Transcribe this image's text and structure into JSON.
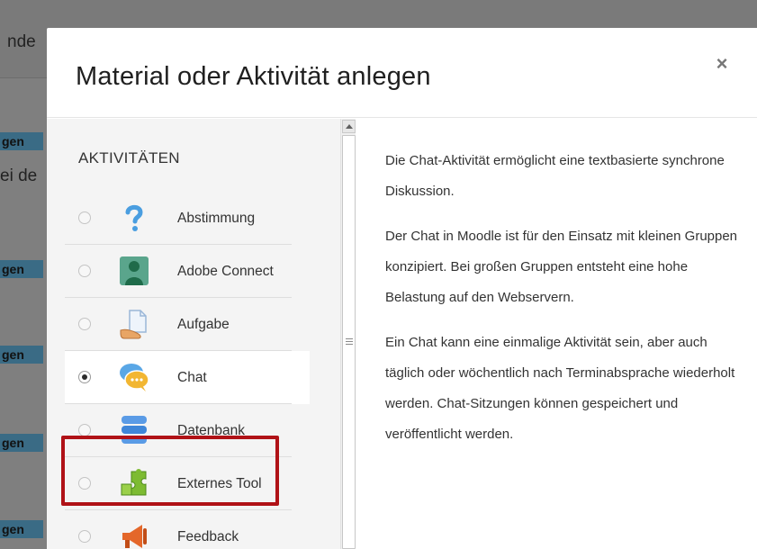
{
  "background": {
    "search_fragment": "nde",
    "badges": [
      "gen",
      "gen",
      "gen",
      "gen",
      "gen"
    ],
    "text_fragment": "ei de"
  },
  "modal": {
    "title": "Material oder Aktivität anlegen",
    "close_symbol": "×"
  },
  "activities": {
    "section_heading": "AKTIVITÄTEN",
    "items": [
      {
        "label": "Abstimmung",
        "icon": "question-icon",
        "selected": false
      },
      {
        "label": "Adobe Connect",
        "icon": "adobe-connect-icon",
        "selected": false
      },
      {
        "label": "Aufgabe",
        "icon": "assignment-icon",
        "selected": false
      },
      {
        "label": "Chat",
        "icon": "chat-icon",
        "selected": true
      },
      {
        "label": "Datenbank",
        "icon": "database-icon",
        "selected": false
      },
      {
        "label": "Externes Tool",
        "icon": "puzzle-icon",
        "selected": false
      },
      {
        "label": "Feedback",
        "icon": "megaphone-icon",
        "selected": false
      }
    ]
  },
  "description": {
    "paragraphs": [
      "Die Chat-Aktivität ermöglicht eine textbasierte synchrone Diskussion.",
      "Der Chat in Moodle ist für den Einsatz mit kleinen Gruppen konzipiert. Bei großen Gruppen entsteht eine hohe Belastung auf den Webservern.",
      "Ein Chat kann eine einmalige Aktivität sein, aber auch täglich oder wöchentlich nach Terminabsprache wiederholt werden. Chat-Sitzungen können gespeichert und veröffentlicht werden."
    ]
  },
  "colors": {
    "highlight_border": "#b01217",
    "overlay": "#808080"
  }
}
